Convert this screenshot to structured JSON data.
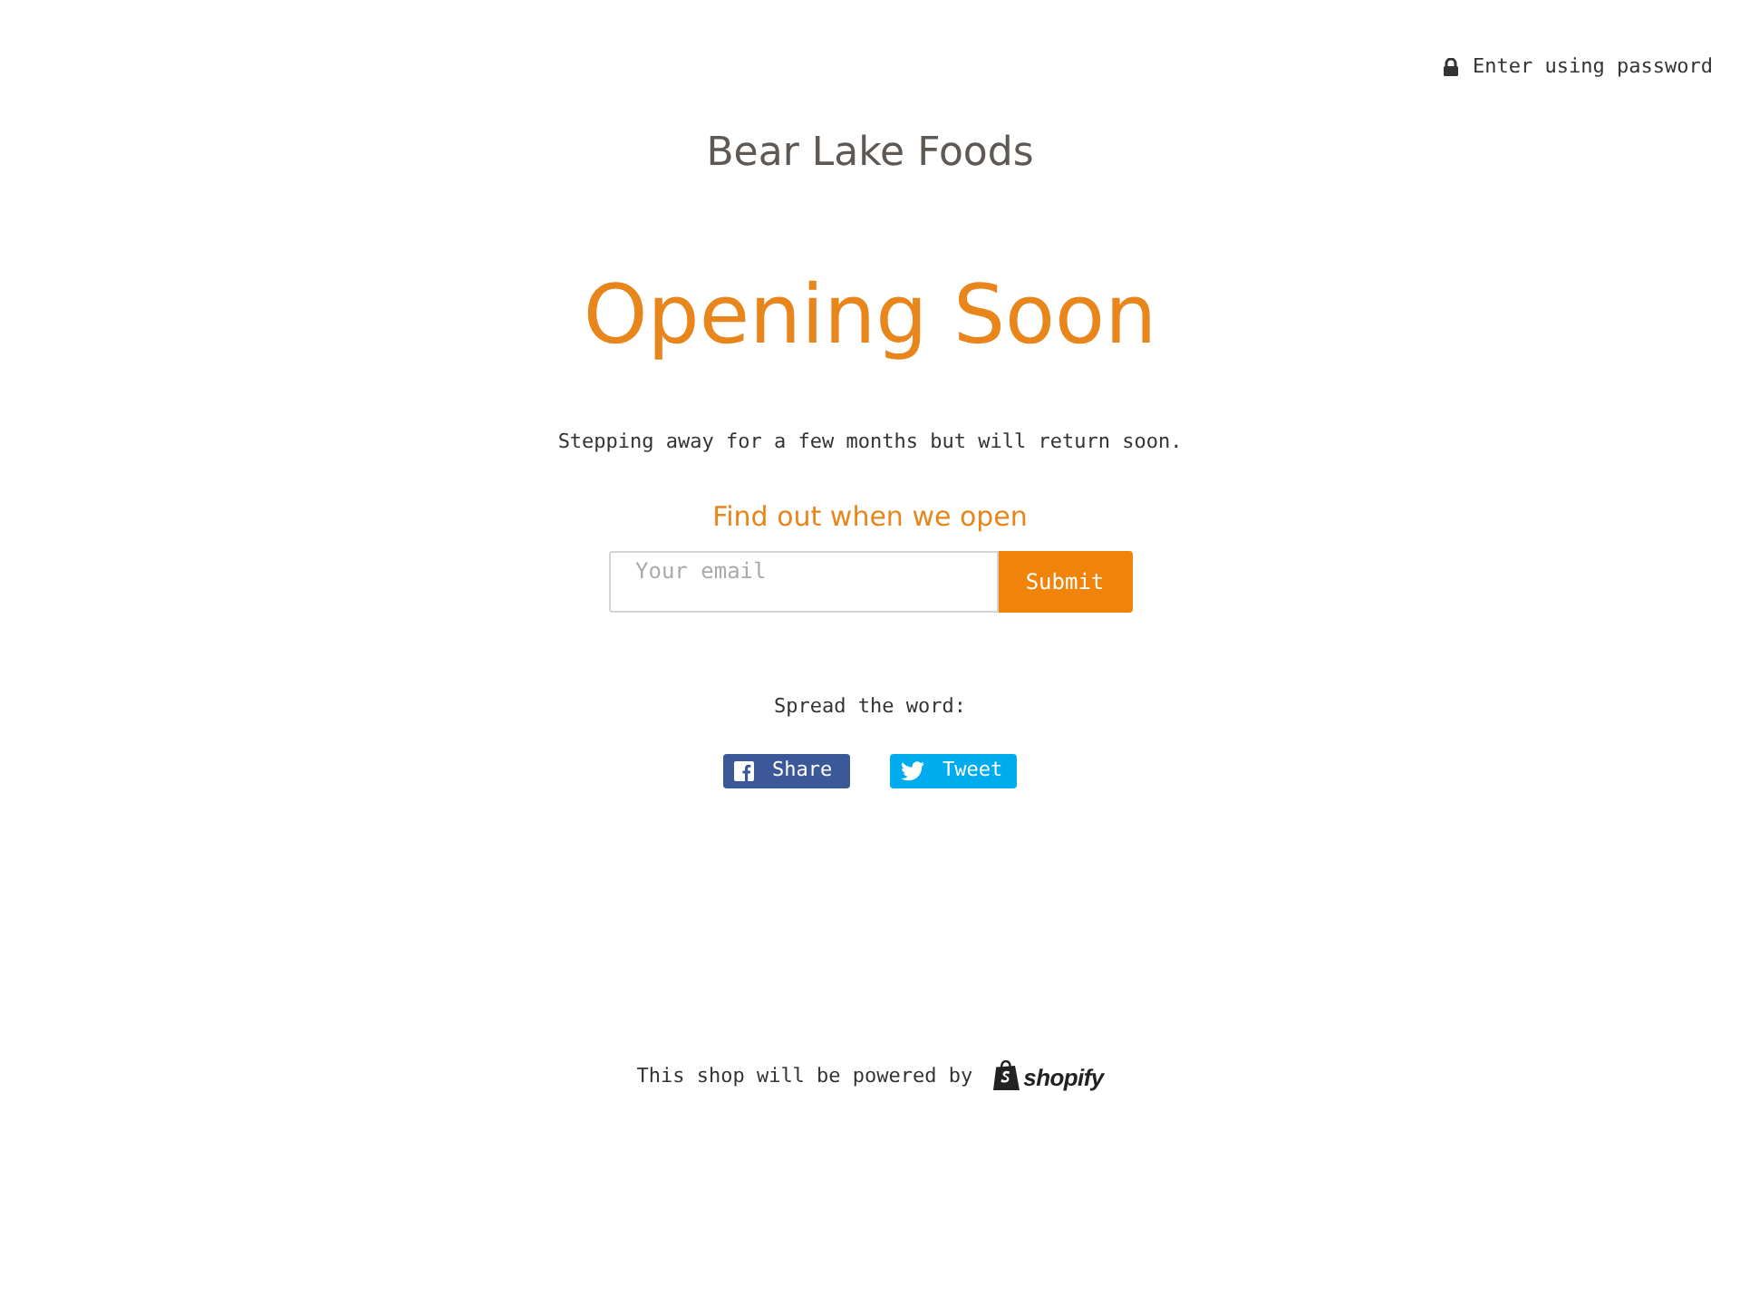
{
  "header": {
    "password_link": "Enter using password"
  },
  "store_name": "Bear Lake Foods",
  "heading": "Opening Soon",
  "message": "Stepping away for a few months but will return soon.",
  "signup": {
    "title": "Find out when we open",
    "email": {
      "placeholder": "Your email"
    },
    "button": "Submit"
  },
  "share": {
    "label": "Spread the word:",
    "buttons": [
      {
        "kind": "facebook",
        "label": "Share",
        "color": "#3b5998"
      },
      {
        "kind": "twitter",
        "label": "Tweet",
        "color": "#00aced"
      }
    ]
  },
  "footer": {
    "text": "This shop will be powered by",
    "logo_text": "shopify"
  }
}
